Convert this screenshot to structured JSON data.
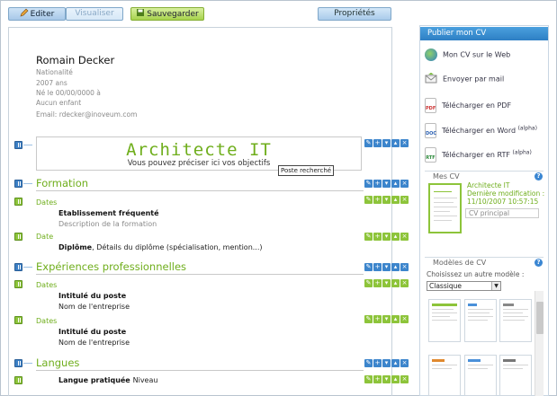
{
  "toolbar": {
    "edit_label": "Editer",
    "view_label": "Visualiser",
    "save_label": "Sauvegarder",
    "props_label": "Propriétés"
  },
  "cv": {
    "name": "Romain Decker",
    "nationality": "Nationalité",
    "age": "2007 ans",
    "birth": "Né le 00/00/0000 à",
    "children": "Aucun enfant",
    "email": "Email: rdecker@inoveum.com",
    "title": "Architecte IT",
    "title_hint": "Vous pouvez préciser ici vos objectifs",
    "tooltip": "Poste recherché"
  },
  "sections": {
    "formation": {
      "title": "Formation",
      "entry1": {
        "date": "Dates",
        "school": "Etablissement fréquenté",
        "description": "Description de la formation"
      },
      "entry2": {
        "date": "Date",
        "diploma": "Diplôme",
        "diploma_details": ", Détails du diplôme (spécialisation, mention...)"
      }
    },
    "experience": {
      "title": "Expériences professionnelles",
      "entry1": {
        "date": "Dates",
        "position": "Intitulé du poste",
        "company": "Nom de l'entreprise"
      },
      "entry2": {
        "date": "Dates",
        "position": "Intitulé du poste",
        "company": "Nom de l'entreprise"
      }
    },
    "languages": {
      "title": "Langues",
      "entry1": {
        "language": "Langue pratiquée",
        "level": "Niveau"
      }
    }
  },
  "sidebar": {
    "header": "Publier mon CV",
    "items": [
      {
        "label": "Mon CV sur le Web",
        "icon": "globe-icon"
      },
      {
        "label": "Envoyer par mail",
        "icon": "envelope-icon"
      },
      {
        "label": "Télécharger en PDF",
        "icon": "pdf-icon"
      },
      {
        "label": "Télécharger en Word",
        "suffix": "(alpha)",
        "icon": "doc-icon"
      },
      {
        "label": "Télécharger en RTF",
        "suffix": "(alpha)",
        "icon": "rtf-icon"
      }
    ],
    "mycv": {
      "label": "Mes CV",
      "cv_title": "Architecte IT",
      "modified_label": "Dernière modification :",
      "modified_date": "11/10/2007 10:57:15",
      "main_label": "CV principal"
    },
    "models": {
      "label": "Modèles de CV",
      "choose": "Choisissez un autre modèle :",
      "selected": "Classique"
    }
  },
  "colors": {
    "accent_green": "#6fae1c",
    "accent_blue": "#2e7fc4"
  }
}
